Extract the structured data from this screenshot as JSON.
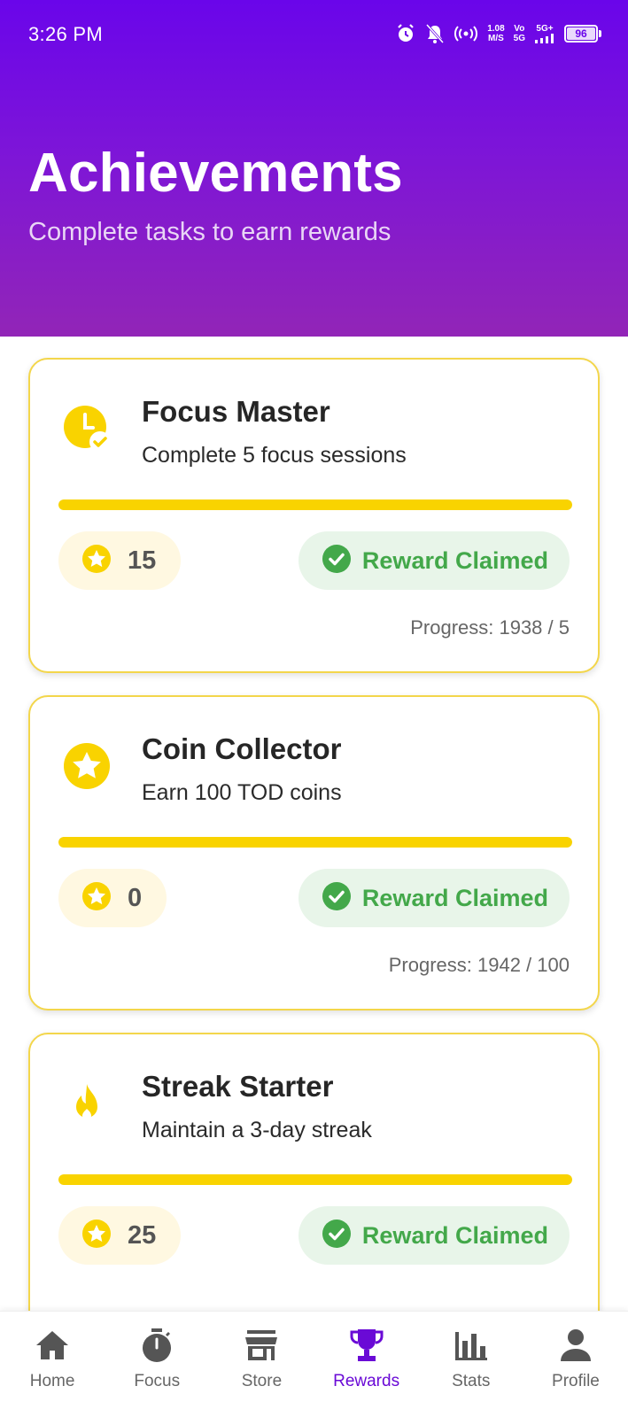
{
  "status": {
    "time": "3:26 PM",
    "net_speed_top": "1.08",
    "net_speed_bottom": "M/S",
    "signal_top": "Vo",
    "signal_bottom": "5G",
    "network": "5G+",
    "battery": "96"
  },
  "header": {
    "title": "Achievements",
    "subtitle": "Complete tasks to earn rewards"
  },
  "colors": {
    "header_top": "#6a05ea",
    "header_bottom": "#9225b7",
    "accent_yellow": "#f9d300",
    "claimed_green": "#43a84a",
    "active_nav": "#6a0ad6"
  },
  "achievements": [
    {
      "icon": "clock-check-icon",
      "title": "Focus Master",
      "description": "Complete 5 focus sessions",
      "reward": "15",
      "status": "Reward Claimed",
      "progress_text": "Progress: 1938 / 5",
      "progress_fraction": 1.0
    },
    {
      "icon": "star-icon",
      "title": "Coin Collector",
      "description": "Earn 100 TOD coins",
      "reward": "0",
      "status": "Reward Claimed",
      "progress_text": "Progress: 1942 / 100",
      "progress_fraction": 1.0
    },
    {
      "icon": "fire-icon",
      "title": "Streak Starter",
      "description": "Maintain a 3-day streak",
      "reward": "25",
      "status": "Reward Claimed",
      "progress_fraction": 1.0
    }
  ],
  "nav": {
    "items": [
      {
        "label": "Home",
        "icon": "home-icon"
      },
      {
        "label": "Focus",
        "icon": "timer-icon"
      },
      {
        "label": "Store",
        "icon": "store-icon"
      },
      {
        "label": "Rewards",
        "icon": "trophy-icon",
        "active": true
      },
      {
        "label": "Stats",
        "icon": "bar-chart-icon"
      },
      {
        "label": "Profile",
        "icon": "person-icon"
      }
    ]
  }
}
